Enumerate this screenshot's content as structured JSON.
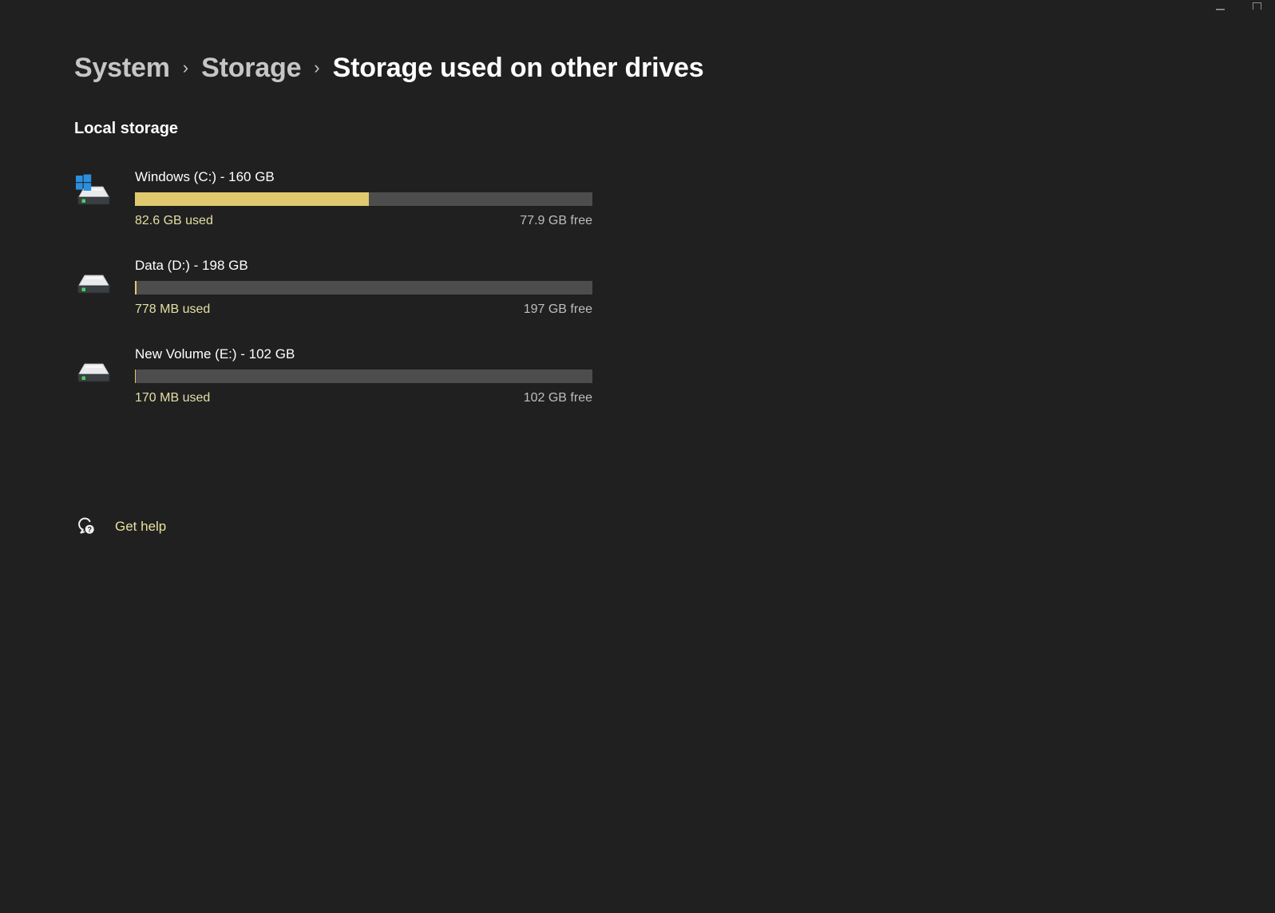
{
  "window": {
    "controls": [
      {
        "name": "minimize",
        "glyph": "minimize-icon"
      },
      {
        "name": "maximize",
        "glyph": "maximize-icon"
      }
    ]
  },
  "breadcrumb": {
    "items": [
      {
        "label": "System",
        "current": false
      },
      {
        "label": "Storage",
        "current": false
      },
      {
        "label": "Storage used on other drives",
        "current": true
      }
    ],
    "separator": "›"
  },
  "main": {
    "section_title": "Local storage",
    "drives": [
      {
        "icon": "windows-drive-icon",
        "name": "Windows (C:) - 160 GB",
        "used_label": "82.6 GB used",
        "free_label": "77.9 GB free",
        "used_percent": 51.2
      },
      {
        "icon": "drive-icon",
        "name": "Data (D:) - 198 GB",
        "used_label": "778 MB used",
        "free_label": "197 GB free",
        "used_percent": 0.4
      },
      {
        "icon": "drive-icon",
        "name": "New Volume (E:) - 102 GB",
        "used_label": "170 MB used",
        "free_label": "102 GB free",
        "used_percent": 0.2
      }
    ]
  },
  "footer": {
    "get_help": {
      "icon": "help-question-icon",
      "label": "Get help"
    }
  },
  "colors": {
    "background": "#202020",
    "bar_fill": "#dfca6f",
    "bar_track": "#4d4d4d",
    "accent_text": "#e8e0a4",
    "muted_text": "#bdbdbd"
  }
}
